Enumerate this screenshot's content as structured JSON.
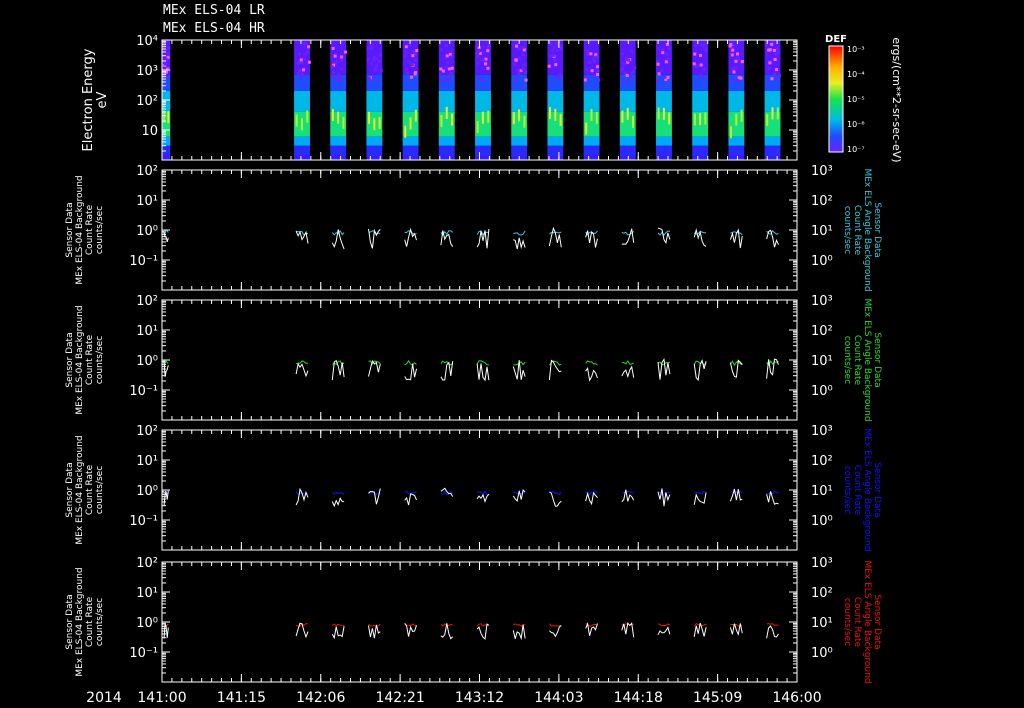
{
  "header": {
    "line1": "MEx ELS-04 LR",
    "line2": "MEx ELS-04 HR"
  },
  "colors": {
    "background": "#000000",
    "axis": "#ffffff",
    "cyan": "#33ccdd",
    "green": "#22dd33",
    "blue": "#1111ff",
    "red": "#ee1111",
    "data_white": "#ffffff"
  },
  "chart_data": [
    {
      "type": "heatmap",
      "name": "spectrogram",
      "ylabel_lines": [
        "Electron Energy",
        "eV"
      ],
      "yscale": "log",
      "ylim": [
        1,
        10000
      ],
      "yticks": [
        {
          "v": 10,
          "l": "10"
        },
        {
          "v": 100,
          "l": "10²"
        },
        {
          "v": 1000,
          "l": "10³"
        },
        {
          "v": 10000,
          "l": "10⁴"
        }
      ],
      "colorbar": {
        "title": "DEF",
        "label": "ergs/(cm**2-sr-sec-eV)",
        "ticks": [
          "10⁻³",
          "10⁻⁴",
          "10⁻⁵",
          "10⁻⁶",
          "10⁻⁷"
        ]
      },
      "data_bursts": [
        {
          "start": 0.0,
          "end": 1.3
        },
        {
          "start": 20.8,
          "end": 23.3
        },
        {
          "start": 26.5,
          "end": 29.0
        },
        {
          "start": 32.2,
          "end": 34.7
        },
        {
          "start": 37.9,
          "end": 40.4
        },
        {
          "start": 43.6,
          "end": 46.1
        },
        {
          "start": 49.3,
          "end": 51.8
        },
        {
          "start": 55.0,
          "end": 57.5
        },
        {
          "start": 60.7,
          "end": 63.2
        },
        {
          "start": 66.4,
          "end": 68.9
        },
        {
          "start": 72.1,
          "end": 74.6
        },
        {
          "start": 77.8,
          "end": 80.3
        },
        {
          "start": 83.5,
          "end": 86.0
        },
        {
          "start": 89.2,
          "end": 91.7
        },
        {
          "start": 94.9,
          "end": 97.4
        }
      ]
    },
    {
      "type": "line",
      "name": "panel-cyan",
      "ylabel_lines": [
        "Sensor Data",
        "MEx ELS-04 Background",
        "Count Rate",
        "counts/sec"
      ],
      "rlabel_lines": [
        "Sensor Data",
        "MEx ELS Angle Background",
        "Count Rate",
        "counts/sec"
      ],
      "color_key": "cyan",
      "yscale": "log",
      "ylim": [
        0.01,
        100
      ],
      "yticks": [
        {
          "v": 0.1,
          "l": "10⁻¹"
        },
        {
          "v": 1,
          "l": "10⁰"
        },
        {
          "v": 10,
          "l": "10¹"
        },
        {
          "v": 100,
          "l": "10²"
        }
      ],
      "rticks": [
        {
          "v": 1,
          "l": "10⁰"
        },
        {
          "v": 10,
          "l": "10¹"
        },
        {
          "v": 100,
          "l": "10²"
        },
        {
          "v": 1000,
          "l": "10³"
        }
      ],
      "rlim": [
        0.1,
        1000
      ],
      "series": [
        {
          "color_key": "cyan",
          "level": 0.8,
          "spread": 0.25
        },
        {
          "color_key": "data_white",
          "level": 0.45,
          "spread": 0.6
        }
      ]
    },
    {
      "type": "line",
      "name": "panel-green",
      "ylabel_lines": [
        "Sensor Data",
        "MEx ELS-04 Background",
        "Count Rate",
        "counts/sec"
      ],
      "rlabel_lines": [
        "Sensor Data",
        "MEx ELS Angle Background",
        "Count Rate",
        "counts/sec"
      ],
      "color_key": "green",
      "yscale": "log",
      "ylim": [
        0.01,
        100
      ],
      "yticks": [
        {
          "v": 0.1,
          "l": "10⁻¹"
        },
        {
          "v": 1,
          "l": "10⁰"
        },
        {
          "v": 10,
          "l": "10¹"
        },
        {
          "v": 100,
          "l": "10²"
        }
      ],
      "rticks": [
        {
          "v": 1,
          "l": "10⁰"
        },
        {
          "v": 10,
          "l": "10¹"
        },
        {
          "v": 100,
          "l": "10²"
        },
        {
          "v": 1000,
          "l": "10³"
        }
      ],
      "rlim": [
        0.1,
        1000
      ],
      "series": [
        {
          "color_key": "green",
          "level": 0.8,
          "spread": 0.25
        },
        {
          "color_key": "data_white",
          "level": 0.4,
          "spread": 0.6
        }
      ]
    },
    {
      "type": "line",
      "name": "panel-blue",
      "ylabel_lines": [
        "Sensor Data",
        "MEx ELS-04 Background",
        "Count Rate",
        "counts/sec"
      ],
      "rlabel_lines": [
        "Sensor Data",
        "MEx ELS Angle Background",
        "Count Rate",
        "counts/sec"
      ],
      "color_key": "blue",
      "yscale": "log",
      "ylim": [
        0.01,
        100
      ],
      "yticks": [
        {
          "v": 0.1,
          "l": "10⁻¹"
        },
        {
          "v": 1,
          "l": "10⁰"
        },
        {
          "v": 10,
          "l": "10¹"
        },
        {
          "v": 100,
          "l": "10²"
        }
      ],
      "rticks": [
        {
          "v": 1,
          "l": "10⁰"
        },
        {
          "v": 10,
          "l": "10¹"
        },
        {
          "v": 100,
          "l": "10²"
        },
        {
          "v": 1000,
          "l": "10³"
        }
      ],
      "rlim": [
        0.1,
        1000
      ],
      "series": [
        {
          "color_key": "blue",
          "level": 0.8,
          "spread": 0.2
        },
        {
          "color_key": "data_white",
          "level": 0.5,
          "spread": 0.5
        }
      ]
    },
    {
      "type": "line",
      "name": "panel-red",
      "ylabel_lines": [
        "Sensor Data",
        "MEx ELS-04 Background",
        "Count Rate",
        "counts/sec"
      ],
      "rlabel_lines": [
        "Sensor Data",
        "MEx ELS Angle Background",
        "Count Rate",
        "counts/sec"
      ],
      "color_key": "red",
      "yscale": "log",
      "ylim": [
        0.01,
        100
      ],
      "yticks": [
        {
          "v": 0.1,
          "l": "10⁻¹"
        },
        {
          "v": 1,
          "l": "10⁰"
        },
        {
          "v": 10,
          "l": "10¹"
        },
        {
          "v": 100,
          "l": "10²"
        }
      ],
      "rticks": [
        {
          "v": 1,
          "l": "10⁰"
        },
        {
          "v": 10,
          "l": "10¹"
        },
        {
          "v": 100,
          "l": "10²"
        },
        {
          "v": 1000,
          "l": "10³"
        }
      ],
      "rlim": [
        0.1,
        1000
      ],
      "series": [
        {
          "color_key": "red",
          "level": 0.8,
          "spread": 0.15
        },
        {
          "color_key": "data_white",
          "level": 0.45,
          "spread": 0.45
        }
      ]
    }
  ],
  "time_axis": {
    "year_label": "2014",
    "tick_labels": [
      "141:00",
      "141:15",
      "142:06",
      "142:21",
      "143:12",
      "144:03",
      "144:18",
      "145:09",
      "146:00"
    ]
  }
}
